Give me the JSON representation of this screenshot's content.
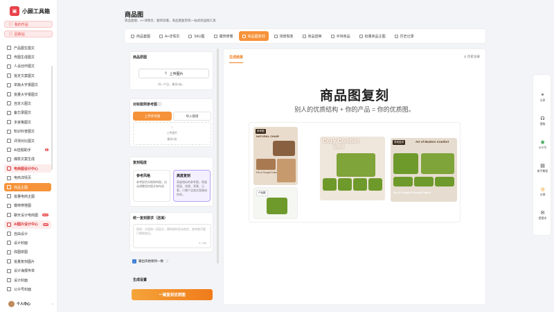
{
  "app": {
    "logo_glyph": "▣",
    "name": "小顾工具箱"
  },
  "sidebar": {
    "top_pills": [
      "我的作品",
      "回收站"
    ],
    "items": [
      "产品图生图文",
      "传图生成图文",
      "人设创作图文",
      "批定文案图文",
      "单篇大字报图文",
      "批量大字报图文",
      "自定义图文",
      "备忘录图文",
      "多宫格图文",
      "知识科普图文",
      "评测对比图文",
      "AI选题助手",
      "爆款文案生成"
    ],
    "ai_badge": "新",
    "section1": "电商图设计中心",
    "section1_items": [
      "电商详情页",
      "商品主图",
      "批量电商主图",
      "模特穿搭图",
      "聊天设计电商图"
    ],
    "section1_badge": "NEW",
    "section2": "AI图片设计中心",
    "section2_items": [
      "自由设计",
      "设计封面",
      "改图拼图",
      "批量复刻图片",
      "设计海报传单",
      "设计封面",
      "公众号封面"
    ],
    "section2_badge": "HOT",
    "user": "个人中心"
  },
  "header": {
    "title": "商品图",
    "subtitle": "商品套图、A+详情页、服饰穿着、商品图复刻等一站式商品图工具"
  },
  "tabs": [
    {
      "label": "商品套图",
      "icon": "grid-icon"
    },
    {
      "label": "A+详情页",
      "icon": "layout-icon"
    },
    {
      "label": "SKU图",
      "icon": "tag-icon"
    },
    {
      "label": "服饰穿着",
      "icon": "shirt-icon"
    },
    {
      "label": "商品图复刻",
      "icon": "copy-icon"
    },
    {
      "label": "场景裂变",
      "icon": "split-icon"
    },
    {
      "label": "商品替换",
      "icon": "swap-icon"
    },
    {
      "label": "手持商品",
      "icon": "hand-icon"
    },
    {
      "label": "批量商品主图",
      "icon": "batch-icon"
    },
    {
      "label": "历史记录",
      "icon": "clock-icon"
    }
  ],
  "form": {
    "product_label": "商品原图",
    "upload_label": "上传图片",
    "upload_hint": "同一产品，最多6张。",
    "ref_label": "对标案例参考图",
    "ref_help": "ⓘ",
    "seg_upload": "上传参考图",
    "seg_link": "导入链接",
    "ref_upload": "上传图片",
    "ref_hint": "最多6张",
    "mode_label": "复刻程度",
    "mode_a_title": "参考风格",
    "mode_a_desc": "参考配色风格和构图，自动调整您的图文和布局",
    "mode_b_title": "高度复刻",
    "mode_b_desc": "高度相似的参考图，保留版面、排版、背景、元素，只替产品和文案做成你的。",
    "req_label": "统一复刻要求（选填）",
    "req_placeholder": "例如：文案统一用英文，模特保持亚洲女性，参考图不要只替换商品。",
    "counter": "0 / 100",
    "keep_style": "输出风格保持一致",
    "keep_help": "ⓘ",
    "settings": "生成设置",
    "cta": "一键复刻优质图"
  },
  "result": {
    "tab": "生成结果",
    "history": "历史记录",
    "hero": "商品图复刻",
    "hero_sub": "别人的优质结构 + 你的产品 = 你的优质图。",
    "ref_tag": "参考图",
    "prod_tag": "产品图",
    "ref_headline": "NATURAL CHAIR",
    "out1_headline": "Cozy Comfort",
    "out1_sub": "ined",
    "out2_headline": "Art of Modern Comfort",
    "out2_tag": "表现复刻",
    "out2_feature": "Pet & People Friendly Fabric",
    "ref_feature": "Pet & People Friendly Fabric"
  },
  "rightbar": [
    {
      "label": "分享",
      "icon": "share-icon"
    },
    {
      "label": "客服",
      "icon": "headset-icon"
    },
    {
      "label": "公众号",
      "icon": "wechat-icon"
    },
    {
      "label": "新手教程",
      "icon": "book-icon"
    },
    {
      "label": "分销",
      "icon": "coin-icon"
    },
    {
      "label": "提需求",
      "icon": "chat-icon"
    }
  ],
  "colors": {
    "accent": "#f6933a",
    "brand": "#e8424a",
    "highlight": "#b7a3f2"
  }
}
